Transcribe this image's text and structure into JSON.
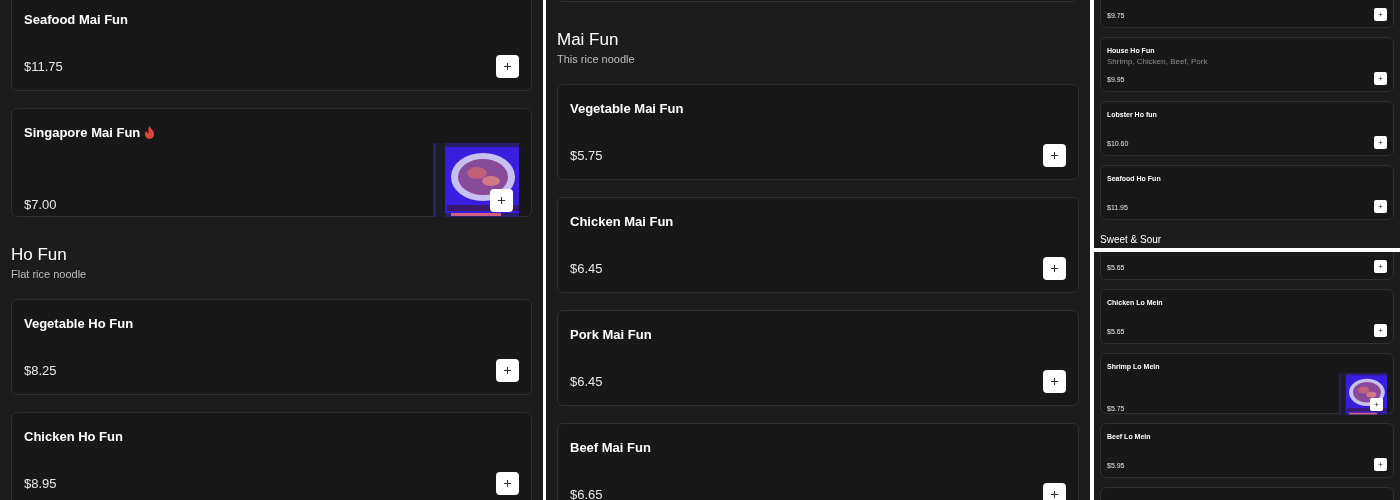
{
  "screens": [
    {
      "blocks": [
        {
          "kind": "item",
          "name": "Seafood Mai Fun",
          "price": "$11.75",
          "spicy": false,
          "picture": false
        },
        {
          "kind": "item",
          "name": "Singapore Mai Fun",
          "price": "$7.00",
          "spicy": true,
          "picture": true
        },
        {
          "kind": "section",
          "title": "Ho Fun",
          "subtitle": "Flat rice noodle"
        },
        {
          "kind": "item",
          "name": "Vegetable Ho Fun",
          "price": "$8.25",
          "spicy": false,
          "picture": false
        },
        {
          "kind": "item",
          "name": "Chicken Ho Fun",
          "price": "$8.95",
          "spicy": false,
          "picture": false
        }
      ]
    },
    {
      "blocks": [
        {
          "kind": "item",
          "picture": false
        },
        {
          "kind": "section",
          "title": "Mai Fun",
          "subtitle": "This rice noodle"
        },
        {
          "kind": "item",
          "name": "Vegetable Mai Fun",
          "price": "$5.75",
          "spicy": false,
          "picture": false
        },
        {
          "kind": "item",
          "name": "Chicken Mai Fun",
          "price": "$6.45",
          "spicy": false,
          "picture": false
        },
        {
          "kind": "item",
          "name": "Pork Mai Fun",
          "price": "$6.45",
          "spicy": false,
          "picture": false
        },
        {
          "kind": "item",
          "name": "Beef Mai Fun",
          "price": "$6.65",
          "spicy": false,
          "picture": false
        }
      ]
    },
    {
      "blocks": [
        {
          "kind": "item",
          "price": "$9.75",
          "picture": false
        },
        {
          "kind": "item",
          "name": "House Ho Fun",
          "description": "Shrimp, Chicken, Beef, Pork",
          "price": "$9.95",
          "spicy": false,
          "picture": false
        },
        {
          "kind": "item",
          "name": "Lobster Ho fun",
          "price": "$10.60",
          "spicy": false,
          "picture": false
        },
        {
          "kind": "item",
          "name": "Seafood Ho Fun",
          "price": "$11.95",
          "spicy": false,
          "picture": false
        },
        {
          "kind": "section",
          "title": "Sweet & Sour"
        }
      ]
    },
    {
      "blocks": [
        {
          "kind": "item",
          "price": "$5.65",
          "picture": false
        },
        {
          "kind": "item",
          "name": "Chicken Lo Mein",
          "price": "$5.65",
          "spicy": false,
          "picture": false
        },
        {
          "kind": "item",
          "name": "Shrimp Lo Mein",
          "price": "$5.75",
          "spicy": false,
          "picture": true
        },
        {
          "kind": "item",
          "name": "Beef Lo Mein",
          "price": "$5.95",
          "spicy": false,
          "picture": false
        },
        {
          "kind": "item",
          "picture": false
        }
      ]
    }
  ]
}
